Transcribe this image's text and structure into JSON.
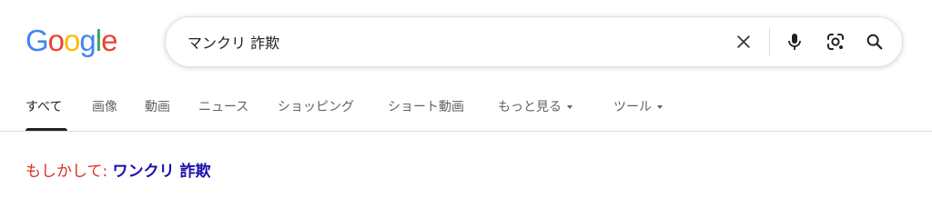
{
  "logo": {
    "letters": [
      "G",
      "o",
      "o",
      "g",
      "l",
      "e"
    ],
    "colors": [
      "#4285F4",
      "#EA4335",
      "#FBBC05",
      "#4285F4",
      "#34A853",
      "#EA4335"
    ]
  },
  "search": {
    "value": "マンクリ 詐欺"
  },
  "icons": {
    "clear": "close-icon",
    "voice": "microphone-icon",
    "lens": "camera-lens-icon",
    "search": "search-icon"
  },
  "tabs": [
    {
      "label": "すべて",
      "active": true
    },
    {
      "label": "画像"
    },
    {
      "label": "動画"
    },
    {
      "label": "ニュース"
    },
    {
      "label": "ショッピング"
    },
    {
      "label": "ショート動画"
    },
    {
      "label": "もっと見る",
      "dropdown": true
    },
    {
      "label": "ツール",
      "dropdown": true
    }
  ],
  "suggestion": {
    "label": "もしかして:",
    "query": "ワンクリ 詐欺"
  },
  "colors": {
    "suggestion_label": "#d93025",
    "suggestion_link": "#1a0dab"
  }
}
